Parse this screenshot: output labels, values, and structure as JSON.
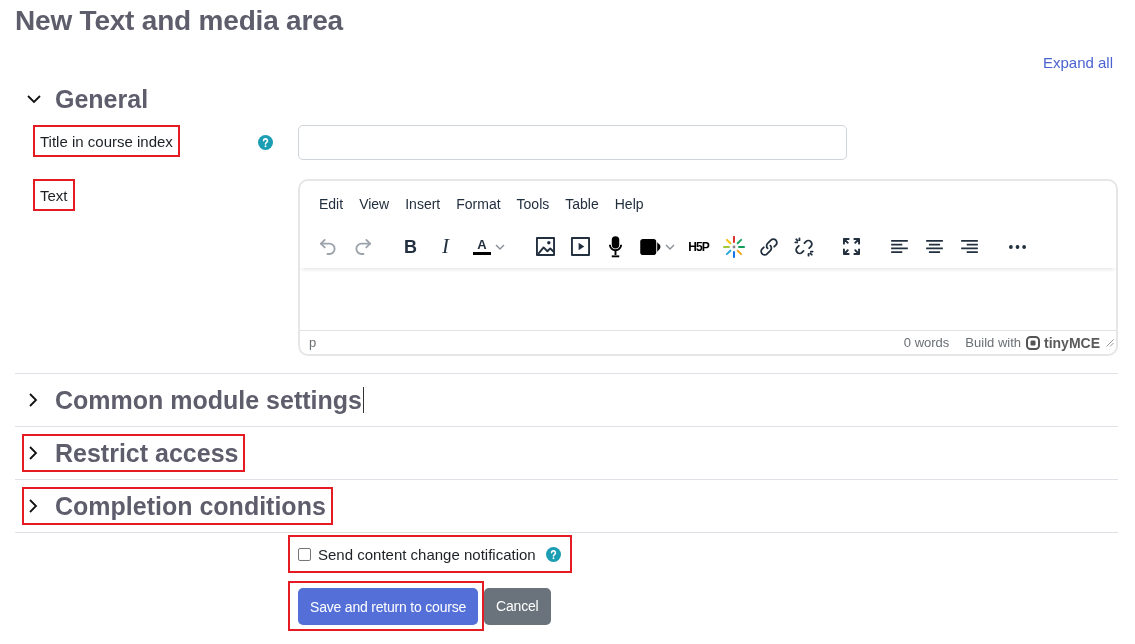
{
  "page_title": "New Text and media area",
  "expand_all": "Expand all",
  "sections": [
    {
      "title": "General",
      "expanded": true,
      "highlighted": false,
      "text_cursor": false,
      "fields": [
        {
          "kind": "input",
          "label": "Title in course index",
          "highlighted": true,
          "help": true
        },
        {
          "kind": "editor",
          "label": "Text",
          "highlighted": true,
          "help": false,
          "editor": {
            "menubar": [
              "Edit",
              "View",
              "Insert",
              "Format",
              "Tools",
              "Table",
              "Help"
            ],
            "toolbar_groups": [
              {
                "buttons": [
                  {
                    "kind": "undo",
                    "disabled": true
                  },
                  {
                    "kind": "redo",
                    "disabled": true
                  }
                ]
              },
              {
                "buttons": [
                  {
                    "kind": "bold",
                    "label": "B",
                    "disabled": false
                  },
                  {
                    "kind": "italic",
                    "label": "I",
                    "disabled": false
                  },
                  {
                    "kind": "font-color",
                    "label": "A",
                    "disabled": false
                  }
                ]
              },
              {
                "buttons": [
                  {
                    "kind": "image",
                    "disabled": false
                  },
                  {
                    "kind": "media",
                    "disabled": false
                  },
                  {
                    "kind": "microphone",
                    "disabled": false
                  },
                  {
                    "kind": "video",
                    "disabled": false
                  },
                  {
                    "kind": "h5p",
                    "label": "H5P",
                    "disabled": false
                  },
                  {
                    "kind": "sparkle",
                    "disabled": false
                  },
                  {
                    "kind": "link",
                    "disabled": false
                  },
                  {
                    "kind": "unlink",
                    "disabled": false
                  }
                ]
              },
              {
                "buttons": [
                  {
                    "kind": "fullscreen",
                    "disabled": false
                  }
                ]
              },
              {
                "buttons": [
                  {
                    "kind": "align-left",
                    "disabled": false
                  },
                  {
                    "kind": "align-center",
                    "disabled": false
                  },
                  {
                    "kind": "align-right",
                    "disabled": false
                  }
                ]
              },
              {
                "buttons": [
                  {
                    "kind": "more",
                    "disabled": false
                  }
                ]
              }
            ],
            "element_path": "p",
            "word_count": "0 words",
            "branding_prefix": "Build with",
            "branding": "tinyMCE"
          }
        }
      ]
    },
    {
      "title": "Common module settings",
      "expanded": false,
      "highlighted": false,
      "text_cursor": true
    },
    {
      "title": "Restrict access",
      "expanded": false,
      "highlighted": true,
      "text_cursor": false
    },
    {
      "title": "Completion conditions",
      "expanded": false,
      "highlighted": true,
      "text_cursor": false
    }
  ],
  "notification": {
    "label": "Send content change notification",
    "checked": false,
    "help": true,
    "highlighted": true
  },
  "buttons": [
    {
      "kind": "primary",
      "label": "Save and return to course",
      "highlighted": true
    },
    {
      "kind": "secondary",
      "label": "Cancel",
      "highlighted": false
    }
  ]
}
